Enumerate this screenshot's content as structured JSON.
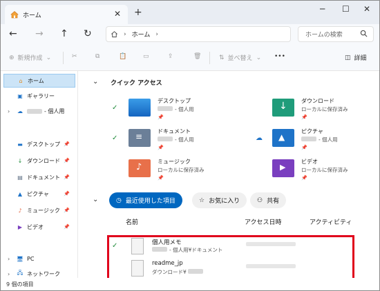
{
  "window": {
    "tab_title": "ホーム",
    "new_tab_symbol": "+",
    "tab_close_symbol": "✕",
    "controls": [
      "─",
      "☐",
      "✕"
    ]
  },
  "nav": {
    "back_symbol": "←",
    "forward_symbol": "→",
    "up_symbol": "↑",
    "refresh_symbol": "↻",
    "breadcrumb": "ホーム",
    "search_placeholder": "ホームの検索"
  },
  "toolbar": {
    "new_label": "新規作成",
    "sort_label": "並べ替え",
    "more_label": "•••",
    "details_label": "詳細"
  },
  "sidebar": {
    "items": [
      {
        "label": "ホーム",
        "icon": "home-icon",
        "selected": true
      },
      {
        "label": "ギャラリー",
        "icon": "gallery-icon"
      },
      {
        "label": "- 個人用",
        "icon": "onedrive-icon"
      },
      {
        "label": "デスクトップ",
        "icon": "desktop-icon"
      },
      {
        "label": "ダウンロード",
        "icon": "download-icon"
      },
      {
        "label": "ドキュメント",
        "icon": "document-icon"
      },
      {
        "label": "ピクチャ",
        "icon": "pictures-icon"
      },
      {
        "label": "ミュージック",
        "icon": "music-icon"
      },
      {
        "label": "ビデオ",
        "icon": "video-icon"
      },
      {
        "label": "PC",
        "icon": "pc-icon"
      },
      {
        "label": "ネットワーク",
        "icon": "network-icon"
      }
    ]
  },
  "quick_access": {
    "title": "クイック アクセス",
    "items": [
      {
        "name": "デスクトップ",
        "sub": "- 個人用",
        "status": "synced"
      },
      {
        "name": "ダウンロード",
        "sub": "ローカルに保存済み",
        "status": ""
      },
      {
        "name": "ドキュメント",
        "sub": "- 個人用",
        "status": "synced"
      },
      {
        "name": "ピクチャ",
        "sub": "- 個人用",
        "status": "cloud"
      },
      {
        "name": "ミュージック",
        "sub": "ローカルに保存済み",
        "status": ""
      },
      {
        "name": "ビデオ",
        "sub": "ローカルに保存済み",
        "status": ""
      }
    ]
  },
  "filters": {
    "recent": "最近使用した項目",
    "favorites": "お気に入り",
    "shared": "共有"
  },
  "columns": {
    "name": "名前",
    "access_time": "アクセス日時",
    "activity": "アクティビティ"
  },
  "files": [
    {
      "name": "個人用メモ",
      "sub": "- 個人用¥ドキュメント",
      "status": "synced"
    },
    {
      "name": "readme_jp",
      "sub": "ダウンロード¥",
      "status": ""
    }
  ],
  "statusbar": {
    "count": "9 個の項目"
  },
  "colors": {
    "accent": "#0067c0",
    "highlight": "#e0001b",
    "synced": "#1f8b3a",
    "selected_bg": "#cce4f7"
  }
}
